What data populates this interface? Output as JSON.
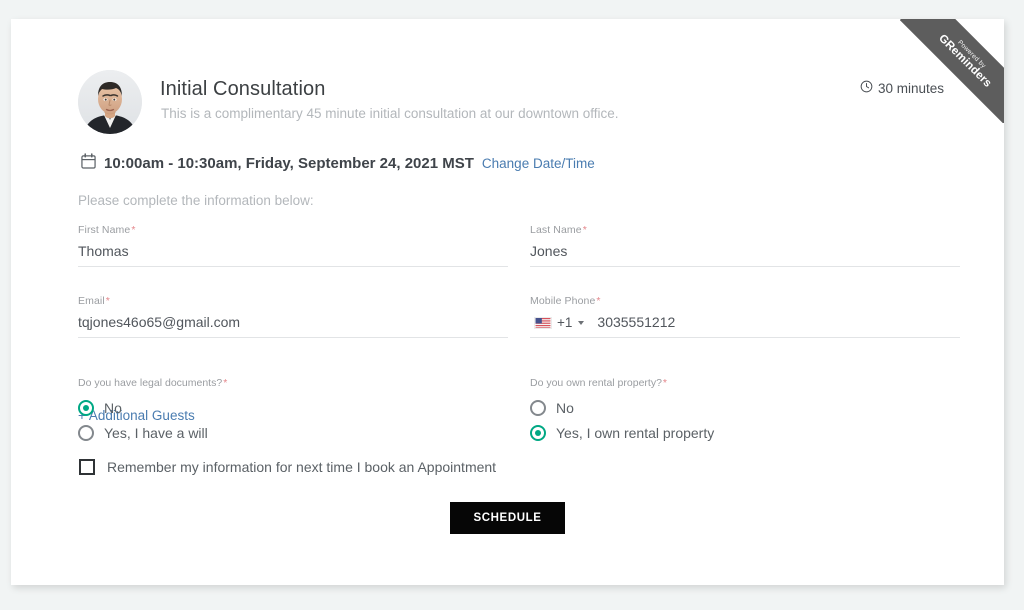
{
  "ribbon": {
    "top_text": "Powered by",
    "brand": "GReminders"
  },
  "header": {
    "title": "Initial Consultation",
    "description": "This is a complimentary 45 minute initial consultation at our downtown office.",
    "duration": "30 minutes",
    "duration_icon": "clock-icon",
    "avatar_alt": "host-avatar"
  },
  "appointment": {
    "calendar_icon": "calendar-icon",
    "datetime": "10:00am - 10:30am, Friday, September 24, 2021 MST",
    "change_link": "Change Date/Time"
  },
  "instruction": "Please complete the information below:",
  "form": {
    "first_name": {
      "label": "First Name",
      "required_mark": "*",
      "value": "Thomas",
      "placeholder": ""
    },
    "last_name": {
      "label": "Last Name",
      "required_mark": "*",
      "value": "Jones",
      "placeholder": ""
    },
    "email": {
      "label": "Email",
      "required_mark": "*",
      "value": "tqjones46o65@gmail.com",
      "placeholder": ""
    },
    "mobile_phone": {
      "label": "Mobile Phone",
      "required_mark": "*",
      "country_flag": "us-flag-icon",
      "dial_code": "+1",
      "value": "3035551212",
      "placeholder": ""
    },
    "additional_guests_link": "+ Additional Guests"
  },
  "questions": [
    {
      "label": "Do you have legal documents?",
      "required_mark": "*",
      "options": [
        {
          "label": "No",
          "selected": true
        },
        {
          "label": "Yes, I have a will",
          "selected": false
        }
      ]
    },
    {
      "label": "Do you own rental property?",
      "required_mark": "*",
      "options": [
        {
          "label": "No",
          "selected": false
        },
        {
          "label": "Yes, I own rental property",
          "selected": true
        }
      ]
    }
  ],
  "remember": {
    "label": "Remember my information for next time I book an Appointment",
    "checked": false
  },
  "submit_label": "SCHEDULE",
  "colors": {
    "page_background": "#f1f4f4",
    "card_background": "#ffffff",
    "ribbon": "#5d5d5d",
    "accent_radio": "#00a884",
    "link": "#4a7cb0",
    "required": "#e4868b",
    "submit_background": "#060606",
    "title_text": "#3c4043",
    "muted_text": "#b3b7bb"
  }
}
